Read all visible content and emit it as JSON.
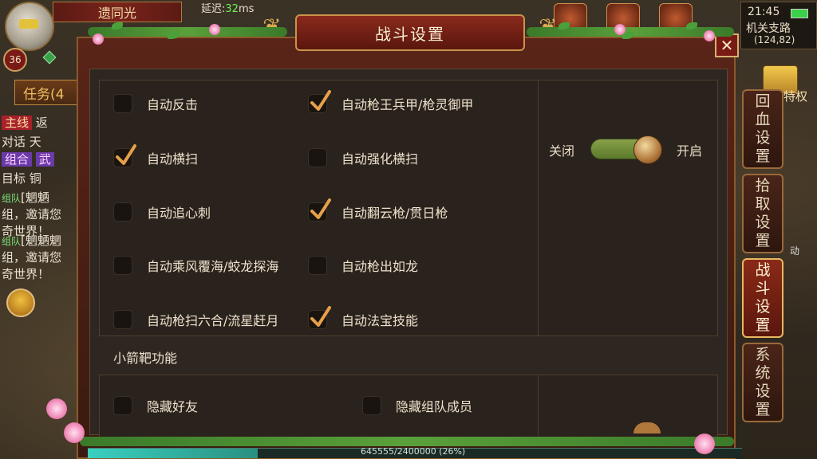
{
  "hud": {
    "player_name": "遗同光",
    "latency_label": "延迟:",
    "latency_value": "32",
    "latency_unit": "ms",
    "level": "36",
    "clock": "21:45",
    "map_name": "机关支路",
    "coords": "(124,82)",
    "vip_label": "特权",
    "side_hint": "动",
    "quest_tab_label": "任务(4",
    "xp_text": "645555/2400000 (26%)",
    "xp_fraction": 0.26,
    "side_rows": [
      {
        "a": "主线",
        "b": "返"
      },
      {
        "a": "对话",
        "b": "天"
      },
      {
        "a": "组合",
        "b": "武"
      },
      {
        "a": "目标",
        "b": "铜"
      }
    ],
    "chat": [
      {
        "tag": "组队",
        "name": "[魍魉"
      },
      {
        "text": "组，邀请您"
      },
      {
        "text": "奇世界！"
      },
      {
        "tag": "组队",
        "name": "[魍魉魍"
      },
      {
        "text": "组，邀请您"
      },
      {
        "text": "奇世界！"
      }
    ]
  },
  "dialog": {
    "title": "战斗设置",
    "close_label": "✕",
    "options": [
      {
        "label": "自动反击",
        "checked": false
      },
      {
        "label": "自动枪王兵甲/枪灵御甲",
        "checked": true
      },
      {
        "label": "自动横扫",
        "checked": true
      },
      {
        "label": "自动强化横扫",
        "checked": false
      },
      {
        "label": "自动追心刺",
        "checked": false
      },
      {
        "label": "自动翻云枪/贯日枪",
        "checked": true
      },
      {
        "label": "自动乘风覆海/蛟龙探海",
        "checked": false
      },
      {
        "label": "自动枪出如龙",
        "checked": false
      },
      {
        "label": "自动枪扫六合/流星赶月",
        "checked": false
      },
      {
        "label": "自动法宝技能",
        "checked": true
      }
    ],
    "toggle": {
      "off_label": "关闭",
      "on_label": "开启",
      "state": "on"
    },
    "section2_heading": "小箭靶功能",
    "section2_options": [
      {
        "label": "隐藏好友",
        "checked": false
      },
      {
        "label": "隐藏组队成员",
        "checked": false
      }
    ]
  },
  "side_tabs": [
    {
      "label": "回血设置",
      "active": false
    },
    {
      "label": "拾取设置",
      "active": false
    },
    {
      "label": "战斗设置",
      "active": true
    },
    {
      "label": "系统设置",
      "active": false
    }
  ],
  "colors": {
    "accent_gold": "#c8944a",
    "check_orange": "#e6a04a",
    "toggle_green": "#8aa04a",
    "active_tab": "#8a2a18"
  }
}
